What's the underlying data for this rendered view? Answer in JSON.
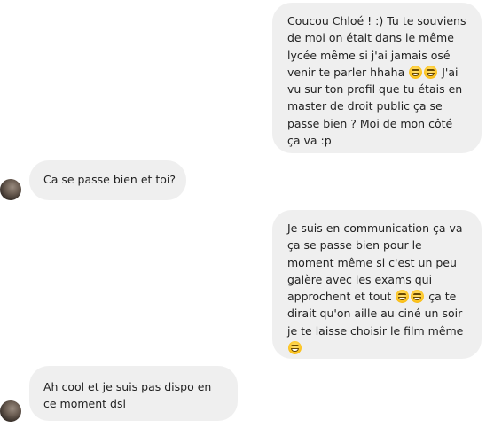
{
  "messages": [
    {
      "direction": "outgoing",
      "text_before": "Coucou Chloé ! :) Tu te souviens\nde moi on était dans le même\nlycée même si j'ai jamais osé\nvenir te parler hhaha ",
      "emojis": [
        "grinning-squinting-face",
        "grinning-squinting-face"
      ],
      "text_after": " J'ai\nvu sur ton profil que tu étais en\nmaster de droit public ça se\npasse bien ? Moi de mon côté\nça va :p"
    },
    {
      "direction": "incoming",
      "text": "Ca se passe bien et toi?"
    },
    {
      "direction": "outgoing",
      "text_before": "Je suis en communication ça va\nça se passe bien pour le\nmoment même si c'est un peu\ngalère avec les exams qui\napprochent et tout ",
      "emojis": [
        "grinning-squinting-face",
        "grinning-squinting-face"
      ],
      "text_after": " ça te\ndirait qu'on aille au ciné un soir\nje te laisse choisir le film même\n",
      "emoji_end": "grinning-squinting-face"
    },
    {
      "direction": "incoming",
      "text": "Ah cool et je suis pas dispo en\nce moment dsl"
    }
  ],
  "colors": {
    "bubble_bg": "#efefef",
    "text": "#222222",
    "page_bg": "#ffffff"
  }
}
